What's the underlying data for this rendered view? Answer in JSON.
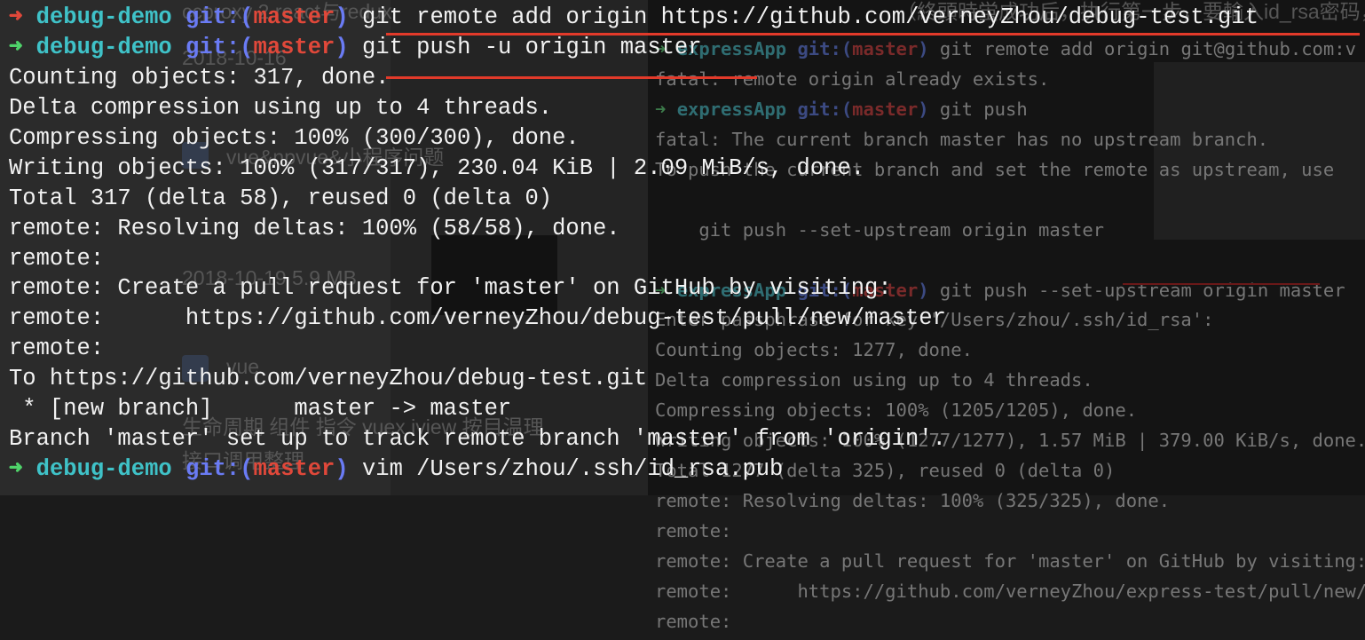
{
  "background": {
    "overlay_text": [
      "ccproxy  2  react与redux",
      "（終頭時蛍成功后，执行第一步，要輸入id_rsa密码，如",
      "2018-10-16",
      "vue&npvue&小程序问题",
      "2018-10-19    5.9 MB",
      "vue",
      "生命周期 组件 指令 vuex iview 按目温理",
      "接口调用整理"
    ],
    "terminal_lines": [
      {
        "prompt": {
          "arrow": "➜",
          "dir": "expressApp",
          "git": "git:(",
          "branch": "master",
          "close": ")"
        },
        "cmd": " git remote add origin git@github.com:v"
      },
      {
        "text": "fatal: remote origin already exists."
      },
      {
        "prompt": {
          "arrow": "➜",
          "dir": "expressApp",
          "git": "git:(",
          "branch": "master",
          "close": ")"
        },
        "cmd": " git push"
      },
      {
        "text": "fatal: The current branch master has no upstream branch."
      },
      {
        "text": "To push the current branch and set the remote as upstream, use"
      },
      {
        "text": ""
      },
      {
        "text": "    git push --set-upstream origin master"
      },
      {
        "text": ""
      },
      {
        "prompt": {
          "arrow": "➜",
          "dir": "expressApp",
          "git": "git:(",
          "branch": "master",
          "close": ")"
        },
        "cmd": " git push --set-upstream origin master"
      },
      {
        "text": "Enter passphrase for key '/Users/zhou/.ssh/id_rsa':"
      },
      {
        "text": "Counting objects: 1277, done."
      },
      {
        "text": "Delta compression using up to 4 threads."
      },
      {
        "text": "Compressing objects: 100% (1205/1205), done."
      },
      {
        "text": "Writing objects: 100% (1277/1277), 1.57 MiB | 379.00 KiB/s, done."
      },
      {
        "text": "Total 1277 (delta 325), reused 0 (delta 0)"
      },
      {
        "text": "remote: Resolving deltas: 100% (325/325), done."
      },
      {
        "text": "remote:"
      },
      {
        "text": "remote: Create a pull request for 'master' on GitHub by visiting:"
      },
      {
        "text": "remote:      https://github.com/verneyZhou/express-test/pull/new/"
      },
      {
        "text": "remote:"
      }
    ]
  },
  "terminal": {
    "lines": [
      {
        "prompt": {
          "arrow": "➜",
          "dir": "debug-demo",
          "git": "git:(",
          "branch": "master",
          "close": ")",
          "status": "failed"
        },
        "cmd": " git remote add origin https://github.com/verneyZhou/debug-test.git"
      },
      {
        "prompt": {
          "arrow": "➜",
          "dir": "debug-demo",
          "git": "git:(",
          "branch": "master",
          "close": ")",
          "status": "ok"
        },
        "cmd": " git push -u origin master"
      },
      {
        "text": "Counting objects: 317, done."
      },
      {
        "text": "Delta compression using up to 4 threads."
      },
      {
        "text": "Compressing objects: 100% (300/300), done."
      },
      {
        "text": "Writing objects: 100% (317/317), 230.04 KiB | 2.09 MiB/s, done."
      },
      {
        "text": "Total 317 (delta 58), reused 0 (delta 0)"
      },
      {
        "text": "remote: Resolving deltas: 100% (58/58), done."
      },
      {
        "text": "remote:"
      },
      {
        "text": "remote: Create a pull request for 'master' on GitHub by visiting:"
      },
      {
        "text": "remote:      https://github.com/verneyZhou/debug-test/pull/new/master"
      },
      {
        "text": "remote:"
      },
      {
        "text": "To https://github.com/verneyZhou/debug-test.git"
      },
      {
        "text": " * [new branch]      master -> master"
      },
      {
        "text": "Branch 'master' set up to track remote branch 'master' from 'origin'."
      },
      {
        "prompt": {
          "arrow": "➜",
          "dir": "debug-demo",
          "git": "git:(",
          "branch": "master",
          "close": ")",
          "status": "ok"
        },
        "cmd": " vim /Users/zhou/.ssh/id_rsa.pub"
      }
    ]
  },
  "colors": {
    "arrow_failed": "#e0483a",
    "arrow_ok": "#4fd36a",
    "dir": "#3fc2c8",
    "git": "#6a7bf4",
    "branch": "#e0483a",
    "text": "#f2f2f2",
    "underline_annotation": "#e23a2a"
  }
}
